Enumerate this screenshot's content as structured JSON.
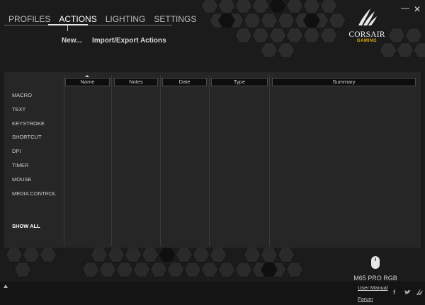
{
  "window": {
    "minimize_glyph": "—",
    "close_glyph": "✕"
  },
  "nav": {
    "tabs": [
      {
        "label": "PROFILES"
      },
      {
        "label": "ACTIONS"
      },
      {
        "label": "LIGHTING"
      },
      {
        "label": "SETTINGS"
      }
    ],
    "active_tab": "ACTIONS"
  },
  "actions_toolbar": {
    "new_label": "New...",
    "import_export_label": "Import/Export Actions"
  },
  "logo": {
    "brand": "CORSAIR",
    "sub": "GAMING",
    "accent_color": "#e2b007"
  },
  "categories": {
    "items": [
      {
        "label": "MACRO"
      },
      {
        "label": "TEXT"
      },
      {
        "label": "KEYSTROKE"
      },
      {
        "label": "SHORTCUT"
      },
      {
        "label": "DPI"
      },
      {
        "label": "TIMER"
      },
      {
        "label": "MOUSE"
      },
      {
        "label": "MEDIA CONTROL"
      }
    ],
    "show_all": "SHOW ALL"
  },
  "table": {
    "columns": [
      "Name",
      "Notes",
      "Date",
      "Type",
      "Summary"
    ],
    "sorted_column": "Name",
    "rows": []
  },
  "device": {
    "name": "M65 PRO RGB",
    "icon": "mouse-icon"
  },
  "footer": {
    "user_manual": "User Manual",
    "forum": "Forum",
    "social_icons": [
      "facebook-icon",
      "twitter-icon",
      "corsair-sails-icon"
    ]
  }
}
